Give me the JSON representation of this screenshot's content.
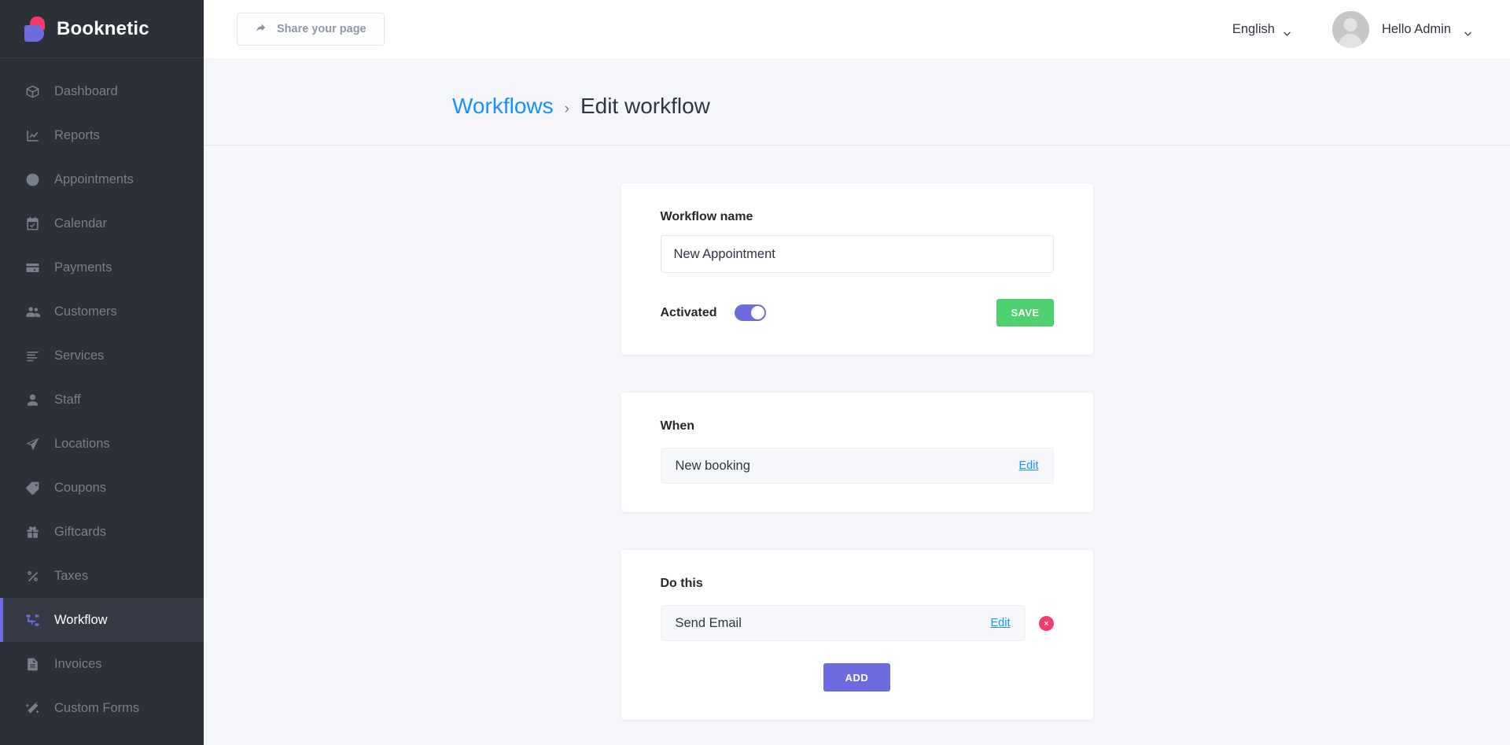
{
  "brand": {
    "name": "Booknetic"
  },
  "sidebar": {
    "items": [
      {
        "label": "Dashboard",
        "icon": "box-icon",
        "active": false
      },
      {
        "label": "Reports",
        "icon": "chart-icon",
        "active": false
      },
      {
        "label": "Appointments",
        "icon": "clock-icon",
        "active": false
      },
      {
        "label": "Calendar",
        "icon": "calendar-icon",
        "active": false
      },
      {
        "label": "Payments",
        "icon": "wallet-icon",
        "active": false
      },
      {
        "label": "Customers",
        "icon": "users-icon",
        "active": false
      },
      {
        "label": "Services",
        "icon": "list-icon",
        "active": false
      },
      {
        "label": "Staff",
        "icon": "person-icon",
        "active": false
      },
      {
        "label": "Locations",
        "icon": "send-icon",
        "active": false
      },
      {
        "label": "Coupons",
        "icon": "tag-icon",
        "active": false
      },
      {
        "label": "Giftcards",
        "icon": "gift-icon",
        "active": false
      },
      {
        "label": "Taxes",
        "icon": "percent-icon",
        "active": false
      },
      {
        "label": "Workflow",
        "icon": "workflow-icon",
        "active": true
      },
      {
        "label": "Invoices",
        "icon": "document-icon",
        "active": false
      },
      {
        "label": "Custom Forms",
        "icon": "magic-wand-icon",
        "active": false
      }
    ]
  },
  "topbar": {
    "share_label": "Share your page",
    "language": "English",
    "user_greeting": "Hello Admin"
  },
  "breadcrumb": {
    "parent": "Workflows",
    "separator": "›",
    "current": "Edit workflow"
  },
  "workflow_card": {
    "name_label": "Workflow name",
    "name_value": "New Appointment",
    "name_placeholder": "Workflow name",
    "activated_label": "Activated",
    "activated_on": true,
    "save_label": "SAVE"
  },
  "when_card": {
    "title": "When",
    "item_label": "New booking",
    "edit_label": "Edit"
  },
  "do_this_card": {
    "title": "Do this",
    "item_label": "Send Email",
    "edit_label": "Edit",
    "delete_icon": "close-circle-icon",
    "add_label": "ADD"
  },
  "colors": {
    "sidebar_bg": "#2C3039",
    "sidebar_active_bg": "#353A44",
    "accent_purple": "#6C6CE0",
    "accent_pink": "#F8396B",
    "save_green": "#4ED06E",
    "delete_red": "#F23D6D",
    "link_blue": "#1890FF",
    "page_bg": "#F4F6FA"
  }
}
